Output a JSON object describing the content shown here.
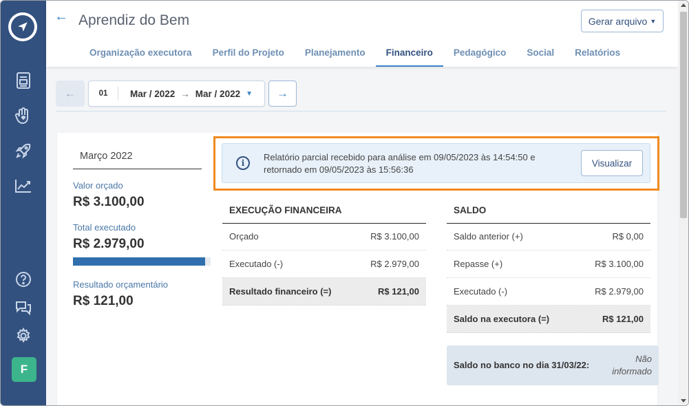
{
  "header": {
    "title": "Aprendiz do Bem",
    "generate_button": "Gerar arquivo",
    "tabs": [
      {
        "label": "Organização executora"
      },
      {
        "label": "Perfil do Projeto"
      },
      {
        "label": "Planejamento"
      },
      {
        "label": "Financeiro"
      },
      {
        "label": "Pedagógico"
      },
      {
        "label": "Social"
      },
      {
        "label": "Relatórios"
      }
    ],
    "active_tab": "Financeiro"
  },
  "period": {
    "number": "01",
    "from": "Mar / 2022",
    "to": "Mar / 2022"
  },
  "summary": {
    "month": "Março 2022",
    "budget_label": "Valor orçado",
    "budget_value": "R$ 3.100,00",
    "executed_label": "Total executado",
    "executed_value": "R$ 2.979,00",
    "executed_progress": 0.96,
    "result_label": "Resultado orçamentário",
    "result_value": "R$ 121,00"
  },
  "alert": {
    "text": "Relatório parcial recebido para análise em 09/05/2023 às 14:54:50 e retornado em 09/05/2023 às 15:56:36",
    "button": "Visualizar",
    "highlight_color": "#f08a1e"
  },
  "financial": {
    "title": "EXECUÇÃO FINANCEIRA",
    "rows": [
      {
        "label": "Orçado",
        "value": "R$ 3.100,00"
      },
      {
        "label": "Executado (-)",
        "value": "R$ 2.979,00"
      }
    ],
    "total": {
      "label": "Resultado financeiro (=)",
      "value": "R$ 121,00"
    }
  },
  "balance": {
    "title": "SALDO",
    "rows": [
      {
        "label": "Saldo anterior (+)",
        "value": "R$ 0,00"
      },
      {
        "label": "Repasse (+)",
        "value": "R$ 3.100,00"
      },
      {
        "label": "Executado (-)",
        "value": "R$ 2.979,00"
      }
    ],
    "total": {
      "label": "Saldo na executora (=)",
      "value": "R$ 121,00"
    }
  },
  "bank": {
    "label": "Saldo no banco no dia 31/03/22:",
    "value": "Não informado"
  },
  "user": {
    "initial": "F"
  },
  "colors": {
    "sidebar": "#33517f",
    "accent": "#3b82c4",
    "avatar": "#3cb58c"
  },
  "icons": [
    "logo-icon",
    "document-icon",
    "hand-heart-icon",
    "rocket-icon",
    "chart-icon",
    "help-icon",
    "chat-icon",
    "gear-icon"
  ]
}
